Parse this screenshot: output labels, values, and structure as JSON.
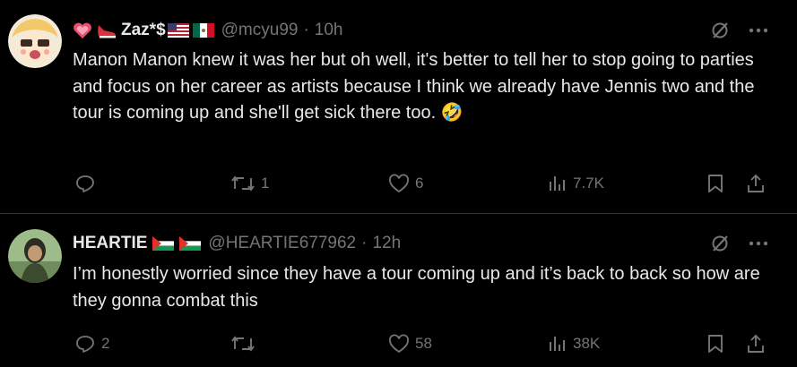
{
  "tweets": [
    {
      "name": "Zaz*$",
      "handle": "@mcyu99",
      "time": "10h",
      "text": "Manon Manon knew it was her but oh well, it's better to tell her to stop going to parties and focus on her career as artists because I think we already have Jennis two and the tour is coming up and she'll get sick there too. 🤣",
      "replies": "",
      "retweets": "1",
      "likes": "6",
      "views": "7.7K"
    },
    {
      "name": "HEARTIE",
      "handle": "@HEARTIE677962",
      "time": "12h",
      "text": "I’m honestly worried since they have a tour coming up and it’s back to back so how are they gonna combat this",
      "replies": "2",
      "retweets": "",
      "likes": "58",
      "views": "38K"
    }
  ],
  "colors": {
    "muted": "#71767b",
    "text": "#e7e9ea",
    "divider": "#2f3336"
  }
}
